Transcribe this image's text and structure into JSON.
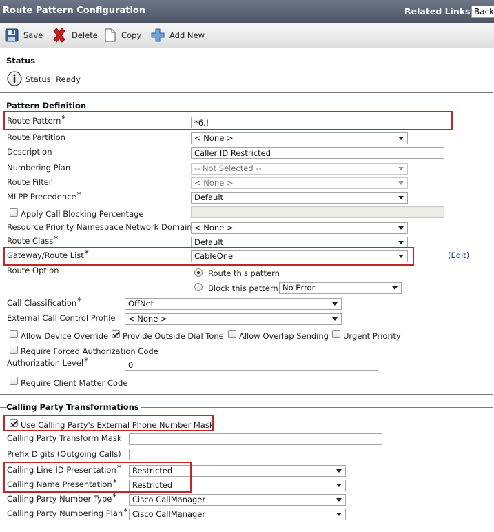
{
  "header": {
    "title": "Route Pattern Configuration",
    "related_links_label": "Related Links:",
    "related_links_value": "Back"
  },
  "toolbar": {
    "save": "Save",
    "delete": "Delete",
    "copy": "Copy",
    "add_new": "Add New"
  },
  "status": {
    "legend": "Status",
    "text": "Status: Ready"
  },
  "pattern": {
    "legend": "Pattern Definition",
    "route_pattern": {
      "label": "Route Pattern",
      "value": "*6.!"
    },
    "route_partition": {
      "label": "Route Partition",
      "value": "< None >"
    },
    "description": {
      "label": "Description",
      "value": "Caller ID Restricted"
    },
    "numbering_plan": {
      "label": "Numbering Plan",
      "value": "-- Not Selected --"
    },
    "route_filter": {
      "label": "Route Filter",
      "value": "< None >"
    },
    "mlpp": {
      "label": "MLPP Precedence",
      "value": "Default"
    },
    "call_blocking": {
      "label": "Apply Call Blocking Percentage",
      "value": ""
    },
    "resource_priority": {
      "label": "Resource Priority Namespace Network Domain",
      "value": "< None >"
    },
    "route_class": {
      "label": "Route Class",
      "value": "Default"
    },
    "gateway": {
      "label": "Gateway/Route List",
      "value": "CableOne",
      "edit": "Edit"
    },
    "route_option": {
      "label": "Route Option",
      "route_this": "Route this pattern",
      "block_this": "Block this pattern",
      "block_reason": "No Error"
    },
    "call_classification": {
      "label": "Call Classification",
      "value": "OffNet"
    },
    "ext_call_control": {
      "label": "External Call Control Profile",
      "value": "< None >"
    },
    "allow_device_override": "Allow Device Override",
    "provide_outside_dial_tone": "Provide Outside Dial Tone",
    "allow_overlap_sending": "Allow Overlap Sending",
    "urgent_priority": "Urgent Priority",
    "require_fac": "Require Forced Authorization Code",
    "auth_level": {
      "label": "Authorization Level",
      "value": "0"
    },
    "require_cmc": "Require Client Matter Code"
  },
  "calling": {
    "legend": "Calling Party Transformations",
    "use_mask": "Use Calling Party's External Phone Number Mask",
    "transform_mask": {
      "label": "Calling Party Transform Mask",
      "value": ""
    },
    "prefix_digits": {
      "label": "Prefix Digits (Outgoing Calls)",
      "value": ""
    },
    "line_id_presentation": {
      "label": "Calling Line ID Presentation",
      "value": "Restricted"
    },
    "name_presentation": {
      "label": "Calling Name Presentation",
      "value": "Restricted"
    },
    "number_type": {
      "label": "Calling Party Number Type",
      "value": "Cisco CallManager"
    },
    "numbering_plan": {
      "label": "Calling Party Numbering Plan",
      "value": "Cisco CallManager"
    }
  },
  "required_mark": "*",
  "colors": {
    "header": "#5a6374",
    "highlight": "#c0262a",
    "link": "#1a3c8f"
  }
}
